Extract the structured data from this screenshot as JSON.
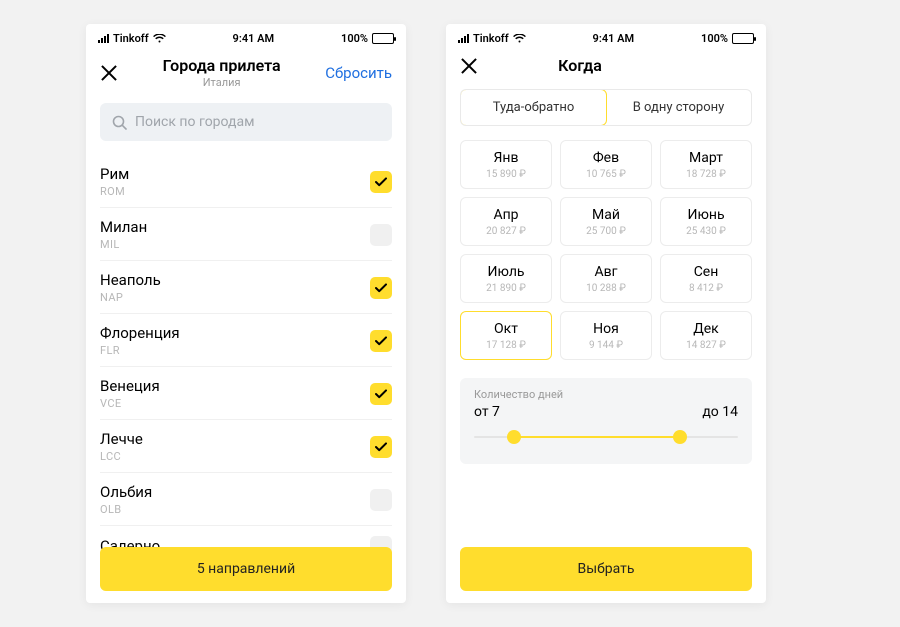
{
  "statusbar": {
    "carrier": "Tinkoff",
    "time": "9:41 AM",
    "battery": "100%"
  },
  "left": {
    "title": "Города прилета",
    "subtitle": "Италия",
    "reset": "Сбросить",
    "search_placeholder": "Поиск по городам",
    "cities": [
      {
        "name": "Рим",
        "code": "ROM",
        "checked": true
      },
      {
        "name": "Милан",
        "code": "MIL",
        "checked": false
      },
      {
        "name": "Неаполь",
        "code": "NAP",
        "checked": true
      },
      {
        "name": "Флоренция",
        "code": "FLR",
        "checked": true
      },
      {
        "name": "Венеция",
        "code": "VCE",
        "checked": true
      },
      {
        "name": "Лечче",
        "code": "LCC",
        "checked": true
      },
      {
        "name": "Ольбия",
        "code": "OLB",
        "checked": false
      },
      {
        "name": "Салерно",
        "code": "",
        "checked": false
      }
    ],
    "button": "5 направлений"
  },
  "right": {
    "title": "Когда",
    "segments": [
      {
        "label": "Туда-обратно",
        "active": true
      },
      {
        "label": "В одну сторону",
        "active": false
      }
    ],
    "months": [
      {
        "name": "Янв",
        "price": "15 890 ₽",
        "active": false
      },
      {
        "name": "Фев",
        "price": "10 765 ₽",
        "active": false
      },
      {
        "name": "Март",
        "price": "18 728 ₽",
        "active": false
      },
      {
        "name": "Апр",
        "price": "20 827 ₽",
        "active": false
      },
      {
        "name": "Май",
        "price": "25 700 ₽",
        "active": false
      },
      {
        "name": "Июнь",
        "price": "25 430 ₽",
        "active": false
      },
      {
        "name": "Июль",
        "price": "21 890 ₽",
        "active": false
      },
      {
        "name": "Авг",
        "price": "10 288 ₽",
        "active": false
      },
      {
        "name": "Сен",
        "price": "8 412 ₽",
        "active": false
      },
      {
        "name": "Окт",
        "price": "17 128 ₽",
        "active": true
      },
      {
        "name": "Ноя",
        "price": "9 144 ₽",
        "active": false
      },
      {
        "name": "Дек",
        "price": "14 827 ₽",
        "active": false
      }
    ],
    "slider": {
      "label": "Количество дней",
      "from": "от 7",
      "to": "до 14",
      "from_pct": 15,
      "to_pct": 78
    },
    "button": "Выбрать"
  }
}
